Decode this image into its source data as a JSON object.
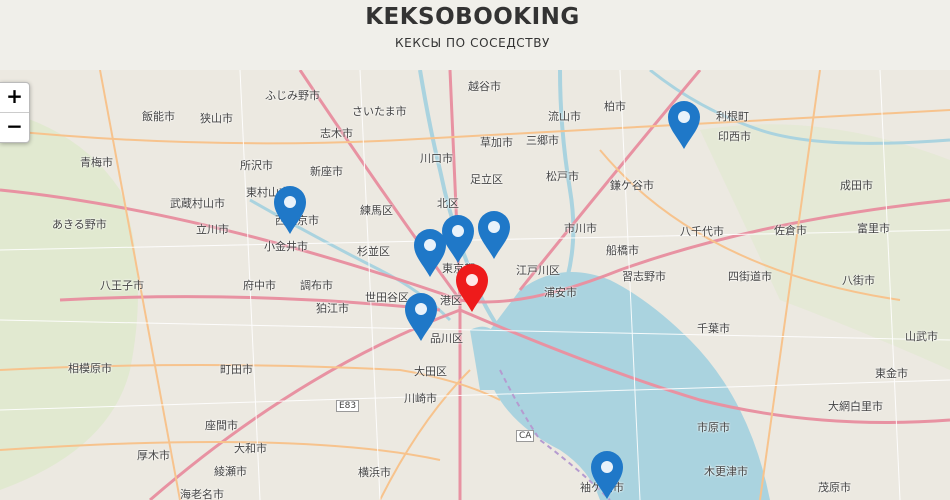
{
  "header": {
    "title": "KEKSOBOOKING",
    "subtitle": "КЕКСЫ ПО СОСЕДСТВУ"
  },
  "zoom": {
    "in": "+",
    "out": "−"
  },
  "map": {
    "labels": [
      "ふじみ野市",
      "さいたま市",
      "越谷市",
      "柏市",
      "飯能市",
      "狭山市",
      "志木市",
      "流山市",
      "草加市",
      "三郷市",
      "利根町",
      "印西市",
      "青梅市",
      "所沢市",
      "新座市",
      "川口市",
      "東村山市",
      "足立区",
      "松戸市",
      "鎌ケ谷市",
      "成田市",
      "武蔵村山市",
      "西東京市",
      "練馬区",
      "北区",
      "市川市",
      "あきる野市",
      "立川市",
      "小金井市",
      "杉並区",
      "八千代市",
      "佐倉市",
      "富里市",
      "江戸川区",
      "船橋市",
      "習志野市",
      "四街道市",
      "八王子市",
      "府中市",
      "調布市",
      "世田谷区",
      "港区",
      "浦安市",
      "八街市",
      "狛江市",
      "品川区",
      "千葉市",
      "山武市",
      "相模原市",
      "町田市",
      "大田区",
      "東金市",
      "川崎市",
      "大網白里市",
      "座間市",
      "市原市",
      "大和市",
      "厚木市",
      "綾瀬市",
      "横浜市",
      "木更津市",
      "袖ケ浦市",
      "茂原市",
      "海老名市",
      "E83",
      "CA",
      "東京都"
    ],
    "pin_colors": {
      "default": "#1f78c8",
      "main": "#ee1b1b"
    }
  }
}
